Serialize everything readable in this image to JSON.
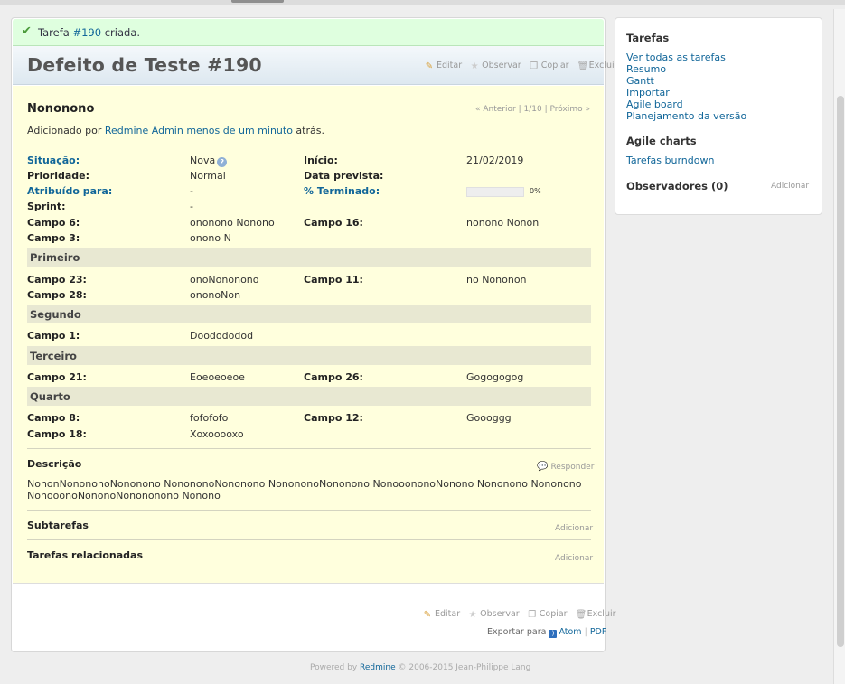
{
  "flash": {
    "prefix": "Tarefa ",
    "issue_link": "#190",
    "suffix": " criada."
  },
  "header": {
    "title": "Defeito de Teste #190"
  },
  "actions": {
    "edit": "Editar",
    "watch": "Observar",
    "copy": "Copiar",
    "delete": "Excluir"
  },
  "issue": {
    "subject": "Nononono",
    "nav": {
      "prev": "« Anterior",
      "sep1": "|",
      "position": "1/10",
      "sep2": "|",
      "next": "Próximo »"
    },
    "author": {
      "prefix": "Adicionado por ",
      "user": "Redmine Admin",
      "space": " ",
      "time": "menos de um minuto",
      "suffix": " atrás."
    },
    "attributes": {
      "status_label": "Situação:",
      "status_value": "Nova",
      "start_label": "Início:",
      "start_value": "21/02/2019",
      "priority_label": "Prioridade:",
      "priority_value": "Normal",
      "due_label": "Data prevista:",
      "assigned_label": "Atribuído para:",
      "assigned_value": "-",
      "done_label": "% Terminado:",
      "done_value": "0%",
      "done_fraction": 0,
      "sprint_label": "Sprint:",
      "sprint_value": "-",
      "c6_label": "Campo 6:",
      "c6_value": "ononono Nonono",
      "c16_label": "Campo 16:",
      "c16_value": "nonono Nonon",
      "c3_label": "Campo 3:",
      "c3_value": "onono N"
    },
    "groups": {
      "g1": "Primeiro",
      "c23_label": "Campo 23:",
      "c23_value": "onoNononono",
      "c11_label": "Campo 11:",
      "c11_value": "no Nononon",
      "c28_label": "Campo 28:",
      "c28_value": "ononoNon",
      "g2": "Segundo",
      "c1_label": "Campo 1:",
      "c1_value": "Doodododod",
      "g3": "Terceiro",
      "c21_label": "Campo 21:",
      "c21_value": "Eoeoeoeoe",
      "c26_label": "Campo 26:",
      "c26_value": "Gogogogog",
      "g4": "Quarto",
      "c8_label": "Campo 8:",
      "c8_value": "fofofofo",
      "c12_label": "Campo 12:",
      "c12_value": "Goooggg",
      "c18_label": "Campo 18:",
      "c18_value": "Xoxooooxo"
    },
    "description": {
      "title": "Descrição",
      "reply": "Responder",
      "line1": "NononNonononoNononono NonononoNononono NonononoNononono NonooononoNonono Nononono Nononono",
      "line2": "NonooonoNononoNonononono Nonono"
    },
    "subtasks": {
      "title": "Subtarefas",
      "add": "Adicionar"
    },
    "related": {
      "title": "Tarefas relacionadas",
      "add": "Adicionar"
    }
  },
  "export": {
    "label": "Exportar para",
    "atom": "Atom",
    "sep": "|",
    "pdf": "PDF"
  },
  "sidebar": {
    "issues_title": "Tarefas",
    "links": [
      "Ver todas as tarefas",
      "Resumo",
      "Gantt",
      "Importar",
      "Agile board",
      "Planejamento da versão"
    ],
    "agile_title": "Agile charts",
    "burndown": "Tarefas burndown",
    "watchers_title": "Observadores (0)",
    "watchers_add": "Adicionar"
  },
  "footer": {
    "prefix": "Powered by ",
    "link": "Redmine",
    "suffix": " © 2006-2015 Jean-Philippe Lang"
  },
  "colors": {
    "link": "#116699",
    "flash_bg": "#dfffdf",
    "issue_bg": "#ffffdd",
    "section_bg": "#e8e8d2"
  },
  "icons": {
    "check": "check-icon",
    "edit": "pencil-icon",
    "watch": "star-icon",
    "copy": "copy-icon",
    "delete": "trash-icon",
    "help": "help-icon",
    "reply": "comment-icon",
    "rss": "rss-icon"
  }
}
